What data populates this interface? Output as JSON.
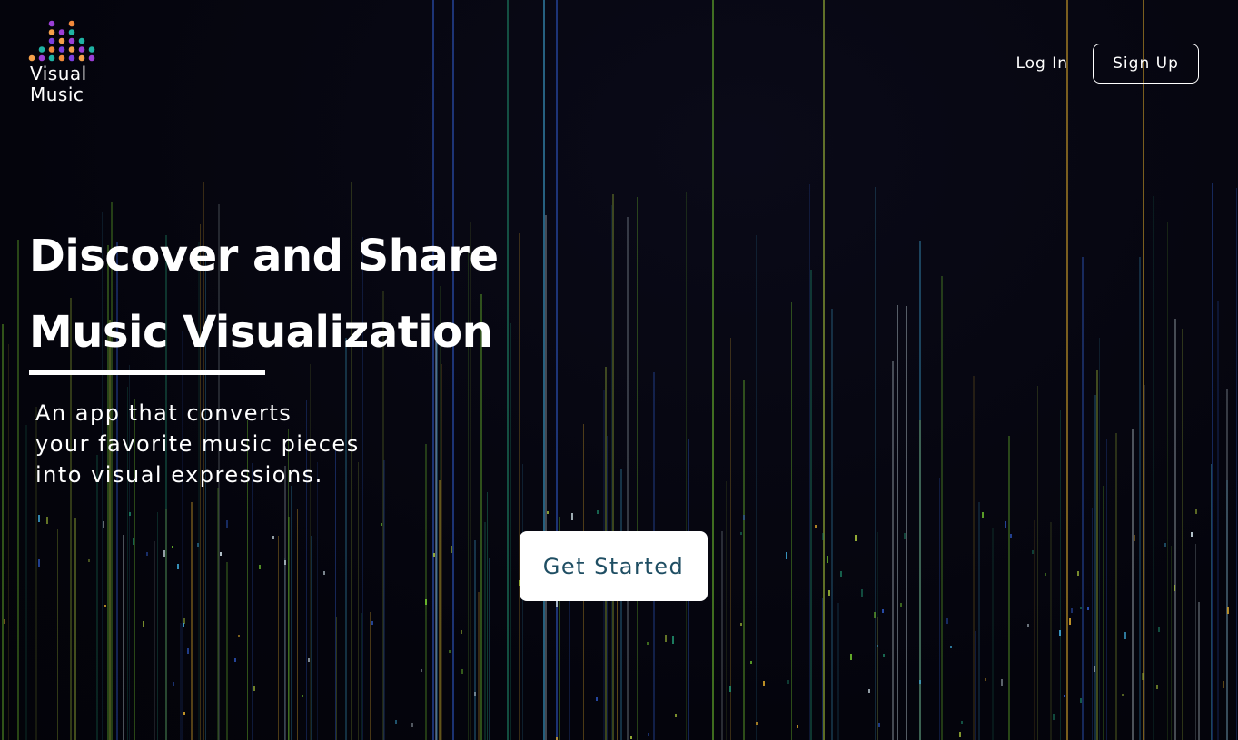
{
  "brand": {
    "line1": "Visual",
    "line2": "Music",
    "dot_colors": [
      "#f4a04a",
      "#9b3fd6",
      "#1fb3a4",
      "#f28a3c",
      "#7b3fe0"
    ]
  },
  "nav": {
    "login_label": "Log In",
    "signup_label": "Sign Up"
  },
  "hero": {
    "title_line1": "Discover and Share",
    "title_line2": "Music Visualization",
    "subtitle_line1": "An app that converts",
    "subtitle_line2": "your favorite music pieces",
    "subtitle_line3": "into visual expressions.",
    "cta_label": "Get Started"
  },
  "colors": {
    "background": "#05050f",
    "text": "#ffffff",
    "cta_text": "#1f4e63",
    "line_palette": [
      "#2f5ac8",
      "#3fa9d8",
      "#6fc22e",
      "#a8c43a",
      "#d9a52a",
      "#1f8a6a",
      "#c8d8e0"
    ]
  }
}
